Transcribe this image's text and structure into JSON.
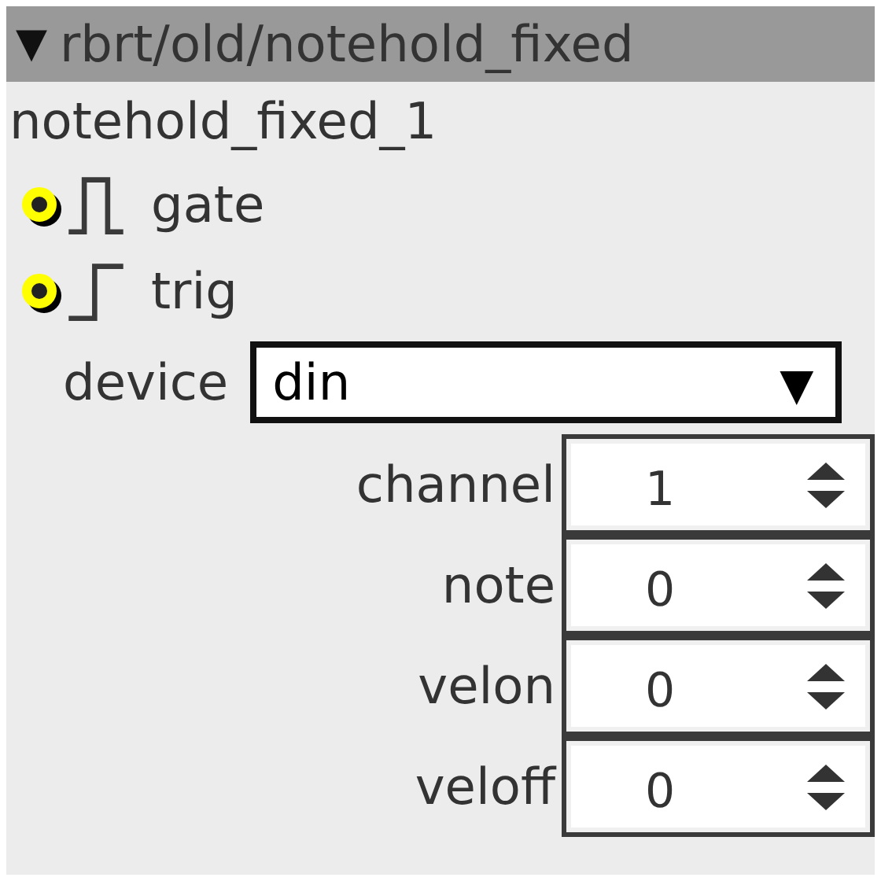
{
  "header": {
    "toggle": "▼",
    "title": "rbrt/old/notehold_fixed"
  },
  "instance_name": "notehold_fixed_1",
  "inlets": [
    {
      "kind": "gate",
      "label": "gate"
    },
    {
      "kind": "trig",
      "label": "trig"
    }
  ],
  "device": {
    "label": "device",
    "value": "din",
    "arrow": "▼"
  },
  "spinners": [
    {
      "label": "channel",
      "value": "1"
    },
    {
      "label": "note",
      "value": "0"
    },
    {
      "label": "velon",
      "value": "0"
    },
    {
      "label": "veloff",
      "value": "0"
    }
  ]
}
